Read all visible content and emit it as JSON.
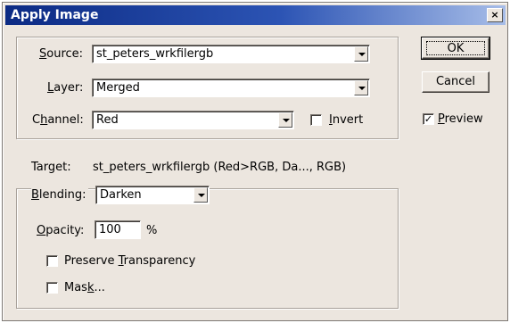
{
  "window": {
    "title": "Apply Image",
    "close_label": "×"
  },
  "source": {
    "label_prefix": "",
    "label_u": "S",
    "label_rest": "ource:",
    "value": "st_peters_wrkfilergb",
    "layer_u": "L",
    "layer_rest": "ayer:",
    "layer_value": "Merged",
    "channel_pre": "C",
    "channel_u": "h",
    "channel_rest": "annel:",
    "channel_value": "Red",
    "invert_u": "I",
    "invert_rest": "nvert",
    "invert_checked": false
  },
  "target": {
    "label": "Target:",
    "value": "st_peters_wrkfilergb (Red>RGB, Da..., RGB)"
  },
  "blending": {
    "label_u": "B",
    "label_rest": "lending:",
    "value": "Darken",
    "opacity_u": "O",
    "opacity_rest": "pacity:",
    "opacity_value": "100",
    "opacity_unit": "%",
    "preserve_pre": "Preserve ",
    "preserve_u": "T",
    "preserve_rest": "ransparency",
    "preserve_checked": false,
    "mask_pre": "Mas",
    "mask_u": "k",
    "mask_rest": "...",
    "mask_checked": false
  },
  "buttons": {
    "ok": "OK",
    "cancel": "Cancel"
  },
  "preview": {
    "label_u": "P",
    "label_rest": "review",
    "checked": true,
    "check_mark": "✓"
  }
}
